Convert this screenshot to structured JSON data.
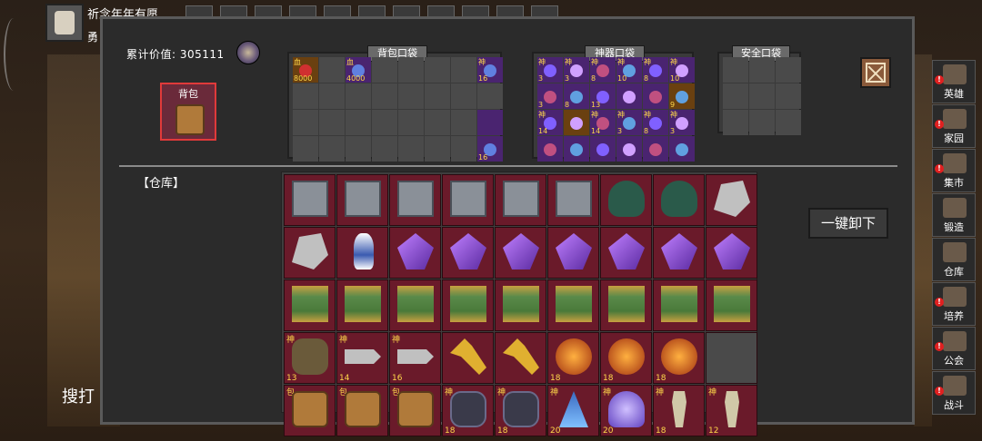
{
  "top": {
    "player_name": "祈念年年有愿",
    "player_sub": "勇"
  },
  "background": {
    "left_text": "搜打"
  },
  "panel": {
    "total_label": "累计价值:",
    "total_value": "305111",
    "bag_button_label": "背包",
    "warehouse_label": "【仓库】",
    "unload_button_label": "一键卸下"
  },
  "pockets": {
    "backpack": {
      "title": "背包口袋",
      "cells": [
        {
          "tag": "血",
          "num": "8000",
          "style": "o",
          "icon": "red-potion-icon"
        },
        {
          "tag": "",
          "num": "",
          "style": "",
          "icon": ""
        },
        {
          "tag": "血",
          "num": "4000",
          "style": "p",
          "icon": "red-flask-icon"
        },
        {
          "tag": "",
          "num": "",
          "style": "",
          "icon": ""
        },
        {
          "tag": "",
          "num": "",
          "style": "",
          "icon": ""
        },
        {
          "tag": "",
          "num": "",
          "style": "",
          "icon": ""
        },
        {
          "tag": "",
          "num": "",
          "style": "",
          "icon": ""
        },
        {
          "tag": "神",
          "num": "16",
          "style": "p",
          "icon": "spirit-icon"
        }
      ],
      "row3": [
        {
          "tag": "",
          "num": "16",
          "style": "p",
          "icon": "shadow-creature-icon"
        }
      ]
    },
    "artifact": {
      "title": "神器口袋",
      "items": [
        {
          "tag": "神",
          "num": "3"
        },
        {
          "tag": "神",
          "num": "3"
        },
        {
          "tag": "神",
          "num": "8"
        },
        {
          "tag": "神",
          "num": "10"
        },
        {
          "tag": "神",
          "num": "8"
        },
        {
          "tag": "神",
          "num": "10"
        },
        {
          "tag": "",
          "num": "3"
        },
        {
          "tag": "",
          "num": "8"
        },
        {
          "tag": "",
          "num": "13"
        },
        {
          "tag": "",
          "num": ""
        },
        {
          "tag": "",
          "num": ""
        },
        {
          "tag": "",
          "num": "9"
        },
        {
          "tag": "神",
          "num": "14"
        },
        {
          "tag": "",
          "num": ""
        },
        {
          "tag": "神",
          "num": "14"
        },
        {
          "tag": "神",
          "num": "3"
        },
        {
          "tag": "神",
          "num": "8"
        },
        {
          "tag": "神",
          "num": "3"
        }
      ]
    },
    "safe": {
      "title": "安全口袋"
    }
  },
  "warehouse": {
    "rows": [
      [
        {
          "icon": "stone-tablet-icon",
          "cls": "stone",
          "tag": "",
          "num": ""
        },
        {
          "icon": "stone-tablet-icon",
          "cls": "stone",
          "tag": "",
          "num": ""
        },
        {
          "icon": "stone-tablet-icon",
          "cls": "stone",
          "tag": "",
          "num": ""
        },
        {
          "icon": "stone-tablet-icon",
          "cls": "stone",
          "tag": "",
          "num": ""
        },
        {
          "icon": "stone-tablet-icon",
          "cls": "stone",
          "tag": "",
          "num": ""
        },
        {
          "icon": "stone-tablet-icon",
          "cls": "stone",
          "tag": "",
          "num": ""
        },
        {
          "icon": "cauldron-icon",
          "cls": "cauldron",
          "tag": "",
          "num": ""
        },
        {
          "icon": "cauldron-icon",
          "cls": "cauldron",
          "tag": "",
          "num": ""
        },
        {
          "icon": "ore-icon",
          "cls": "ore",
          "tag": "",
          "num": ""
        }
      ],
      [
        {
          "icon": "ore-icon",
          "cls": "ore",
          "tag": "",
          "num": ""
        },
        {
          "icon": "porcelain-vase-icon",
          "cls": "vase",
          "tag": "",
          "num": ""
        },
        {
          "icon": "crystal-icon",
          "cls": "crystal",
          "tag": "",
          "num": ""
        },
        {
          "icon": "crystal-icon",
          "cls": "crystal",
          "tag": "",
          "num": ""
        },
        {
          "icon": "crystal-icon",
          "cls": "crystal",
          "tag": "",
          "num": ""
        },
        {
          "icon": "crystal-icon",
          "cls": "crystal",
          "tag": "",
          "num": ""
        },
        {
          "icon": "crystal-icon",
          "cls": "crystal",
          "tag": "",
          "num": ""
        },
        {
          "icon": "crystal-icon",
          "cls": "crystal",
          "tag": "",
          "num": ""
        },
        {
          "icon": "crystal-icon",
          "cls": "crystal",
          "tag": "",
          "num": ""
        }
      ],
      [
        {
          "icon": "scroll-icon",
          "cls": "scroll",
          "tag": "",
          "num": ""
        },
        {
          "icon": "scroll-icon",
          "cls": "scroll",
          "tag": "",
          "num": ""
        },
        {
          "icon": "scroll-icon",
          "cls": "scroll",
          "tag": "",
          "num": ""
        },
        {
          "icon": "scroll-icon",
          "cls": "scroll",
          "tag": "",
          "num": ""
        },
        {
          "icon": "scroll-icon",
          "cls": "scroll",
          "tag": "",
          "num": ""
        },
        {
          "icon": "scroll-icon",
          "cls": "scroll",
          "tag": "",
          "num": ""
        },
        {
          "icon": "scroll-icon",
          "cls": "scroll",
          "tag": "",
          "num": ""
        },
        {
          "icon": "scroll-icon",
          "cls": "scroll",
          "tag": "",
          "num": ""
        },
        {
          "icon": "scroll-icon",
          "cls": "scroll",
          "tag": "",
          "num": ""
        }
      ],
      [
        {
          "icon": "beast-icon",
          "cls": "beast",
          "tag": "神",
          "num": "13"
        },
        {
          "icon": "bolt-icon",
          "cls": "bolt",
          "tag": "神",
          "num": "14"
        },
        {
          "icon": "bolt-icon",
          "cls": "bolt",
          "tag": "神",
          "num": "16"
        },
        {
          "icon": "key-icon",
          "cls": "key",
          "tag": "",
          "num": ""
        },
        {
          "icon": "key-icon",
          "cls": "key",
          "tag": "",
          "num": ""
        },
        {
          "icon": "orb-icon",
          "cls": "orb",
          "tag": "",
          "num": "18"
        },
        {
          "icon": "orb-icon",
          "cls": "orb",
          "tag": "",
          "num": "18"
        },
        {
          "icon": "orb-icon",
          "cls": "orb",
          "tag": "",
          "num": "18"
        },
        {
          "icon": "",
          "cls": "",
          "tag": "",
          "num": ""
        }
      ],
      [
        {
          "icon": "treasure-bag-icon",
          "cls": "bag",
          "tag": "包",
          "num": ""
        },
        {
          "icon": "treasure-bag-icon",
          "cls": "bag",
          "tag": "包",
          "num": ""
        },
        {
          "icon": "treasure-bag-icon",
          "cls": "bag",
          "tag": "包",
          "num": ""
        },
        {
          "icon": "demon-mask-icon",
          "cls": "mask",
          "tag": "神",
          "num": "18"
        },
        {
          "icon": "demon-mask-icon",
          "cls": "mask",
          "tag": "神",
          "num": "18"
        },
        {
          "icon": "crystal-robe-icon",
          "cls": "robe",
          "tag": "神",
          "num": "20"
        },
        {
          "icon": "jellyfish-icon",
          "cls": "jelly",
          "tag": "神",
          "num": "20"
        },
        {
          "icon": "skeleton-icon",
          "cls": "skel",
          "tag": "神",
          "num": "18"
        },
        {
          "icon": "skeleton-icon",
          "cls": "skel",
          "tag": "神",
          "num": "12"
        }
      ]
    ]
  },
  "menu": [
    {
      "label": "英雄",
      "icon": "hero-helmet-icon",
      "badge": "!"
    },
    {
      "label": "家园",
      "icon": "home-gate-icon",
      "badge": "!"
    },
    {
      "label": "集市",
      "icon": "market-icon",
      "badge": "!"
    },
    {
      "label": "锻造",
      "icon": "anvil-icon",
      "badge": ""
    },
    {
      "label": "仓库",
      "icon": "warehouse-icon",
      "badge": ""
    },
    {
      "label": "培养",
      "icon": "cultivate-icon",
      "badge": "!"
    },
    {
      "label": "公会",
      "icon": "guild-icon",
      "badge": "!"
    },
    {
      "label": "战斗",
      "icon": "battle-portal-icon",
      "badge": "!"
    }
  ]
}
